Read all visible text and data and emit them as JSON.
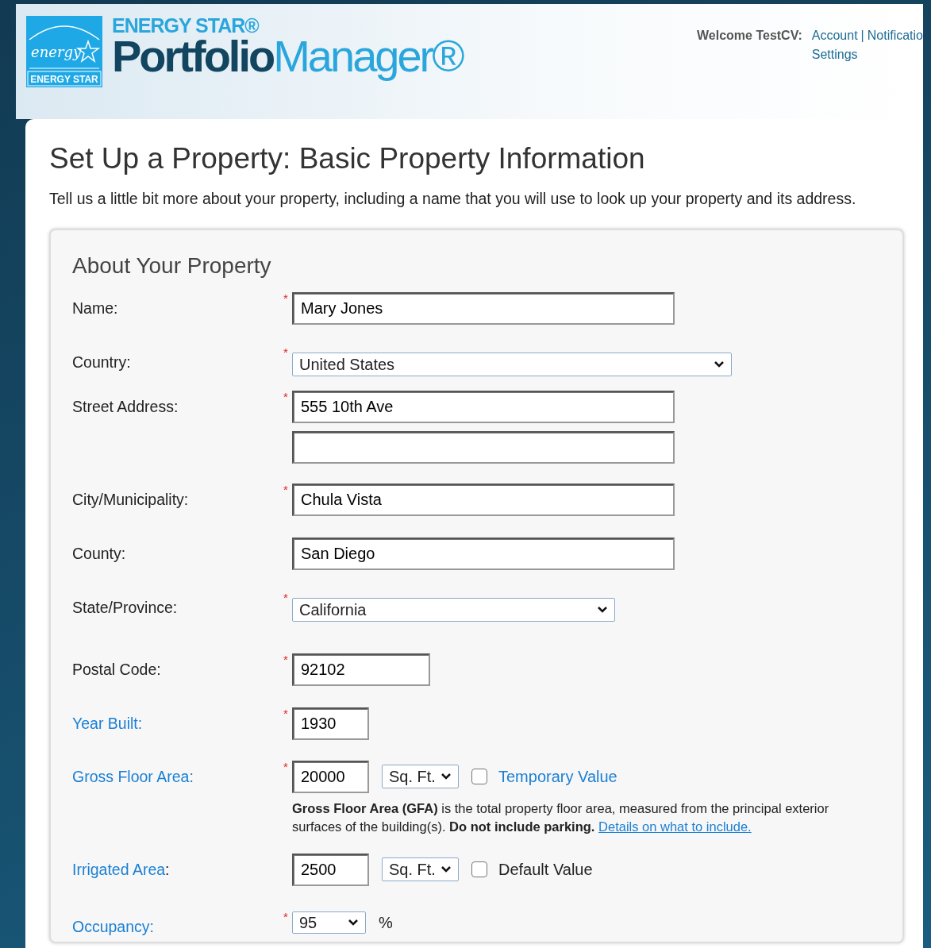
{
  "header": {
    "logo": {
      "script": "energy",
      "band": "ENERGY STAR"
    },
    "brand_top": "ENERGY STAR®",
    "brand_bold": "Portfolio",
    "brand_light": "Manager®",
    "welcome": "Welcome TestCV:",
    "links": [
      {
        "label": "Account"
      },
      {
        "label": "Notificatio"
      },
      {
        "label": "Settings"
      }
    ],
    "separator": "|"
  },
  "page": {
    "title": "Set Up a Property: Basic Property Information",
    "intro": "Tell us a little bit more about your property, including a name that you will use to look up your property and its address."
  },
  "section": {
    "title": "About Your Property",
    "required_mark": "*",
    "fields": [
      {
        "kind": "text",
        "label": "Name:",
        "link": false,
        "required": true,
        "value": "Mary Jones"
      },
      {
        "kind": "select",
        "label": "Country:",
        "link": false,
        "required": true,
        "value": "United States"
      },
      {
        "kind": "address",
        "label": "Street Address:",
        "link": false,
        "required": true,
        "value": "555 10th Ave"
      },
      {
        "kind": "text",
        "label": "City/Municipality:",
        "link": false,
        "required": true,
        "value": "Chula Vista"
      },
      {
        "kind": "text",
        "label": "County:",
        "link": false,
        "required": false,
        "value": "San Diego"
      },
      {
        "kind": "select",
        "label": "State/Province:",
        "link": false,
        "required": true,
        "value": "California"
      },
      {
        "kind": "text",
        "label": "Postal Code:",
        "link": false,
        "required": true,
        "value": "92102"
      },
      {
        "kind": "text",
        "label": "Year Built:",
        "link": true,
        "required": true,
        "value": "1930"
      },
      {
        "kind": "area",
        "label": "Gross Floor Area:",
        "link": true,
        "required": true,
        "value": "20000",
        "unit": "Sq. Ft.",
        "checkbox": {
          "label": "Temporary Value",
          "link": true,
          "checked": false
        },
        "help": "**Gross Floor Area (GFA)** is the total property floor area, measured from the principal exterior surfaces of the building(s). **Do not include parking.**",
        "help_link": "Details on what to include."
      },
      {
        "kind": "area",
        "label": "Irrigated Area",
        "label_after": ":",
        "link": true,
        "required": false,
        "value": "2500",
        "unit": "Sq. Ft.",
        "checkbox": {
          "label": "Default Value",
          "link": false,
          "checked": false
        }
      },
      {
        "kind": "percent",
        "label": "Occupancy:",
        "link": true,
        "required": true,
        "value": "95",
        "suffix": "%"
      }
    ]
  }
}
